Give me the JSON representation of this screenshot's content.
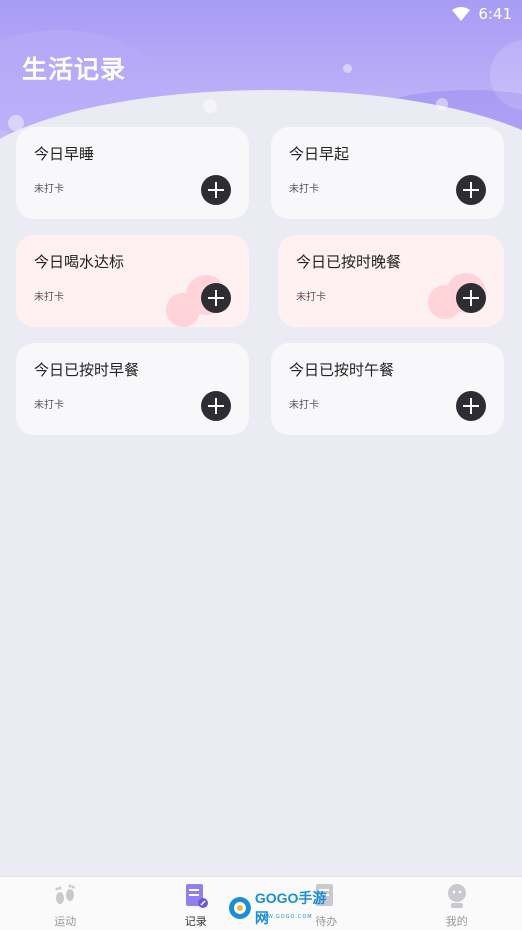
{
  "status_bar": {
    "time": "6:41",
    "wifi_icon": "wifi-icon"
  },
  "page": {
    "title": "生活记录"
  },
  "cards": [
    {
      "title": "今日早睡",
      "status": "未打卡",
      "theme": "white",
      "icon": "plus-icon"
    },
    {
      "title": "今日早起",
      "status": "未打卡",
      "theme": "white",
      "icon": "plus-icon"
    },
    {
      "title": "今日喝水达标",
      "status": "未打卡",
      "theme": "pink",
      "icon": "plus-icon"
    },
    {
      "title": "今日已按时晚餐",
      "status": "未打卡",
      "theme": "pink",
      "icon": "plus-icon"
    },
    {
      "title": "今日已按时早餐",
      "status": "未打卡",
      "theme": "white",
      "icon": "plus-icon"
    },
    {
      "title": "今日已按时午餐",
      "status": "未打卡",
      "theme": "white",
      "icon": "plus-icon"
    }
  ],
  "tabbar": {
    "items": [
      {
        "label": "运动",
        "icon": "footprints-icon",
        "active": false
      },
      {
        "label": "记录",
        "icon": "document-edit-icon",
        "active": true
      },
      {
        "label": "待办",
        "icon": "todo-icon",
        "active": false
      },
      {
        "label": "我的",
        "icon": "profile-icon",
        "active": false
      }
    ]
  },
  "watermark": {
    "text": "GOGO手游网",
    "sub": "WWW.GOGO.COM"
  },
  "colors": {
    "accent": "#a89bf4",
    "pink_card": "#fff0f1",
    "add_button": "#2d2d33"
  }
}
